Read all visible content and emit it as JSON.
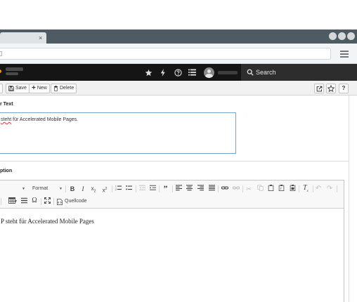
{
  "browser": {
    "tab_close_glyph": "×"
  },
  "header": {
    "search_label": "Search"
  },
  "toolbar": {
    "save_label": "Save",
    "new_label": "New",
    "delete_label": "Delete"
  },
  "form": {
    "amp_text_label": "r Text",
    "amp_text_value_spell": "steht",
    "amp_text_value_rest": " für Accelerated Mobile Pages.",
    "caption_label": "ption"
  },
  "editor": {
    "format_label": "Format",
    "source_label": "Quellcode",
    "content": "P steht für Accelerated Mobile Pages"
  },
  "colors": {
    "header_bg": "#151515",
    "search_bg": "#2d2d2d",
    "chrome_bg": "#4f5b62",
    "focus_border": "#7aa3c8",
    "logo_accent": "#f49700"
  }
}
